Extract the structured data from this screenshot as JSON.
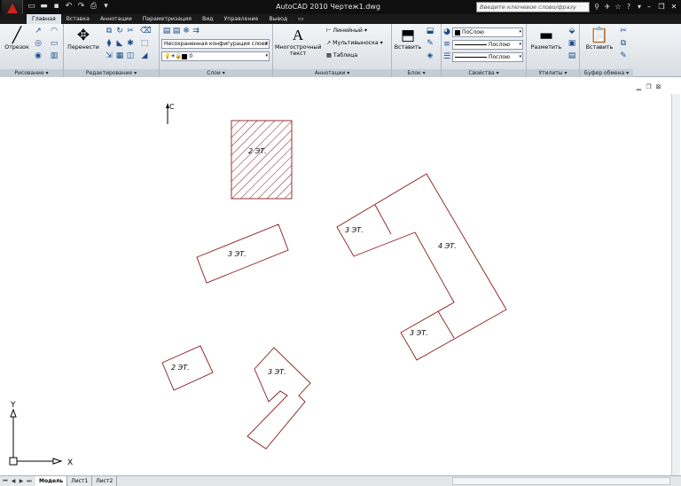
{
  "window": {
    "title": "AutoCAD 2010    Чертеж1.dwg",
    "search_placeholder": "Введите ключевое слово/фразу"
  },
  "tabs": [
    "Главная",
    "Вставка",
    "Аннотации",
    "Параметризация",
    "Вид",
    "Управление",
    "Вывод"
  ],
  "active_tab": "Главная",
  "ribbon": {
    "draw": {
      "title": "Рисование",
      "line_label": "Отрезок"
    },
    "modify": {
      "title": "Редактирование",
      "move_label": "Перенести"
    },
    "layers": {
      "title": "Слои",
      "layer_state": "Несохраненная конфигурация слоев",
      "current_layer": "0"
    },
    "annotation": {
      "title": "Аннотации",
      "mtext_label_1": "Многострочный",
      "mtext_label_2": "текст",
      "dim_linear": "Линейный",
      "multileader": "Мультивыноска",
      "table": "Таблица"
    },
    "block": {
      "title": "Блок",
      "insert_label": "Вставить"
    },
    "properties": {
      "title": "Свойства",
      "color": "ПоСлою",
      "linetype": "Послою",
      "lineweight": "Послою"
    },
    "utilities": {
      "title": "Утилиты",
      "measure_label": "Разметить"
    },
    "clipboard": {
      "title": "Буфер обмена",
      "paste_label": "Вставить"
    }
  },
  "drawing": {
    "north_label": "С",
    "ucs_x": "X",
    "ucs_y": "Y",
    "labels": [
      "2 ЭТ.",
      "3 ЭТ.",
      "3 ЭТ.",
      "4 ЭТ.",
      "3 ЭТ.",
      "2 ЭТ.",
      "3 ЭТ."
    ],
    "line_color": "#8b1a1a"
  },
  "layout_tabs": [
    "Модель",
    "Лист1",
    "Лист2"
  ],
  "active_layout": "Модель",
  "icons": [
    "autocad-logo-icon",
    "new-icon",
    "open-icon",
    "save-icon",
    "undo-icon",
    "redo-icon",
    "print-icon",
    "search-icon",
    "binoculars-icon",
    "star-icon",
    "help-icon",
    "close-icon"
  ]
}
